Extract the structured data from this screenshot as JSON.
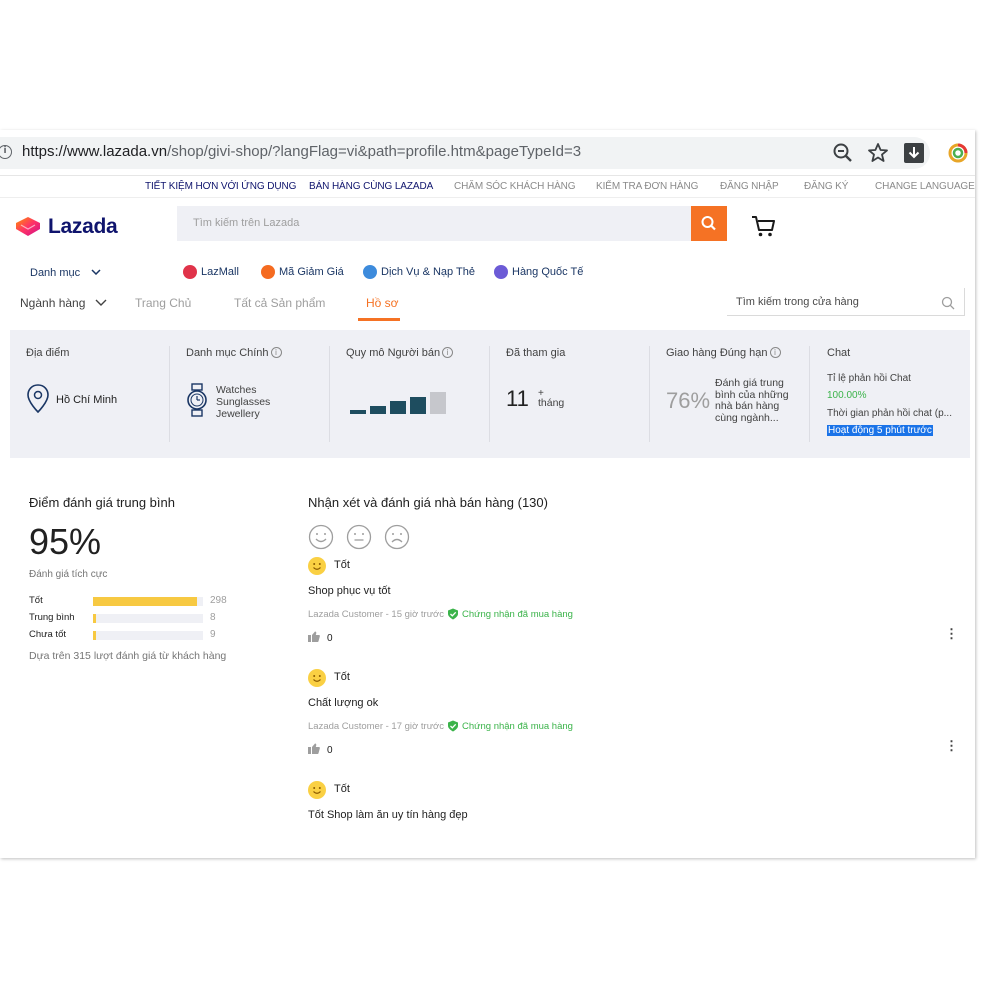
{
  "browser": {
    "url_host": "https://www.lazada.vn",
    "url_path": "/shop/givi-shop/?langFlag=vi&path=profile.htm&pageTypeId=3"
  },
  "top_links": [
    "TIẾT KIỆM HƠN VỚI ỨNG DỤNG",
    "BÁN HÀNG CÙNG LAZADA",
    "CHĂM SÓC KHÁCH HÀNG",
    "KIỂM TRA ĐƠN HÀNG",
    "ĐĂNG NHẬP",
    "ĐĂNG KÝ",
    "CHANGE LANGUAGE"
  ],
  "header": {
    "logo_text": "Lazada",
    "search_placeholder": "Tìm kiếm trên Lazada"
  },
  "category_row": {
    "menu_label": "Danh mục",
    "chips": [
      "LazMall",
      "Mã Giảm Giá",
      "Dịch Vụ & Nạp Thẻ",
      "Hàng Quốc Tế"
    ]
  },
  "store_nav": {
    "tabs": [
      "Ngành hàng",
      "Trang Chủ",
      "Tất cả Sản phẩm",
      "Hồ sơ"
    ],
    "active_tab": "Hồ sơ",
    "search_placeholder": "Tìm kiếm trong cửa hàng"
  },
  "profile": {
    "location_label": "Địa điểm",
    "location_value": "Hồ Chí Minh",
    "category_label": "Danh mục Chính",
    "categories": [
      "Watches",
      "Sunglasses",
      "Jewellery"
    ],
    "size_label": "Quy mô Người bán",
    "size_level": 4,
    "size_max": 5,
    "joined_label": "Đã tham gia",
    "joined_value": "11",
    "joined_plus": "+",
    "joined_unit": "tháng",
    "ontime_label": "Giao hàng Đúng hạn",
    "ontime_value": "76%",
    "ontime_desc": "Đánh giá trung bình của những nhà bán hàng cùng ngành...",
    "chat_label": "Chat",
    "chat_rate_label": "Tỉ lệ phản hồi Chat",
    "chat_rate_value": "100.00%",
    "chat_time_label": "Thời gian phản hồi chat (p...",
    "chat_active": "Hoạt động 5 phút trước"
  },
  "rating": {
    "title": "Điểm đánh giá trung bình",
    "score": "95%",
    "score_caption": "Đánh giá tích cực",
    "rows": [
      {
        "label": "Tốt",
        "count": "298",
        "fraction": 0.946
      },
      {
        "label": "Trung bình",
        "count": "8",
        "fraction": 0.025
      },
      {
        "label": "Chưa tốt",
        "count": "9",
        "fraction": 0.029
      }
    ],
    "footnote": "Dựa trên 315 lượt đánh giá từ khách hàng"
  },
  "reviews": {
    "title": "Nhận xét và đánh giá nhà bán hàng (130)",
    "items": [
      {
        "sentiment": "Tốt",
        "text": "Shop phục vụ tốt",
        "meta": "Lazada Customer - 15 giờ trước",
        "verified": "Chứng nhận đã mua hàng",
        "likes": "0"
      },
      {
        "sentiment": "Tốt",
        "text": "Chất lượng ok",
        "meta": "Lazada Customer - 17 giờ trước",
        "verified": "Chứng nhận đã mua hàng",
        "likes": "0"
      },
      {
        "sentiment": "Tốt",
        "text": "Tốt Shop làm ăn uy tín hàng đẹp"
      }
    ]
  },
  "colors": {
    "accent": "#f57224",
    "navy": "#0f146d",
    "green": "#3bb34a",
    "star": "#f7c942",
    "highlight": "#1a73e8"
  }
}
